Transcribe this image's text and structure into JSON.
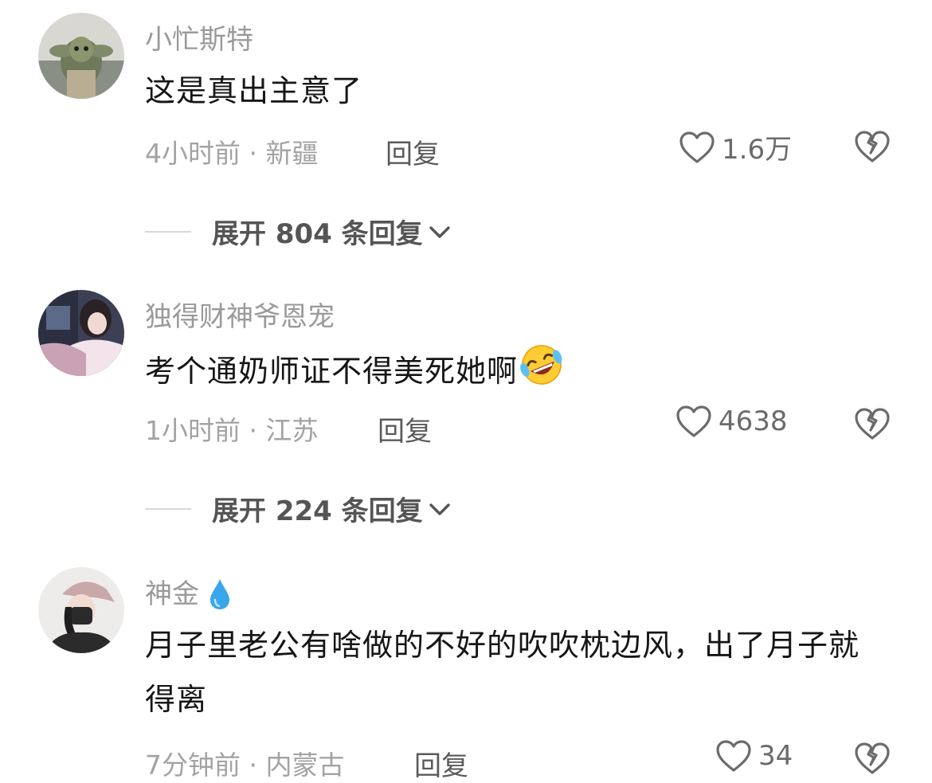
{
  "comments": [
    {
      "username": "小忙斯特",
      "content": "这是真出主意了",
      "time": "4小时前 · 新疆",
      "reply_label": "回复",
      "likes": "1.6万",
      "expand_label": "展开 804 条回复"
    },
    {
      "username": "独得财神爷恩宠",
      "content": "考个通奶师证不得美死她啊",
      "time": "1小时前 · 江苏",
      "reply_label": "回复",
      "likes": "4638",
      "expand_label": "展开 224 条回复"
    },
    {
      "username": "神金",
      "content": "月子里老公有啥做的不好的吹吹枕边风，出了月子就得离",
      "time": "7分钟前 · 内蒙古",
      "reply_label": "回复",
      "likes": "34"
    }
  ],
  "icons": {
    "like": "heart-outline-icon",
    "dislike": "broken-heart-icon",
    "expand": "chevron-down-icon",
    "emoji_laugh": "rolling-on-floor-laughing-emoji",
    "emoji_drop": "droplet-emoji"
  },
  "colors": {
    "username": "#9a9a9a",
    "meta": "#a3a3a3",
    "icon": "#6b6b6b"
  }
}
